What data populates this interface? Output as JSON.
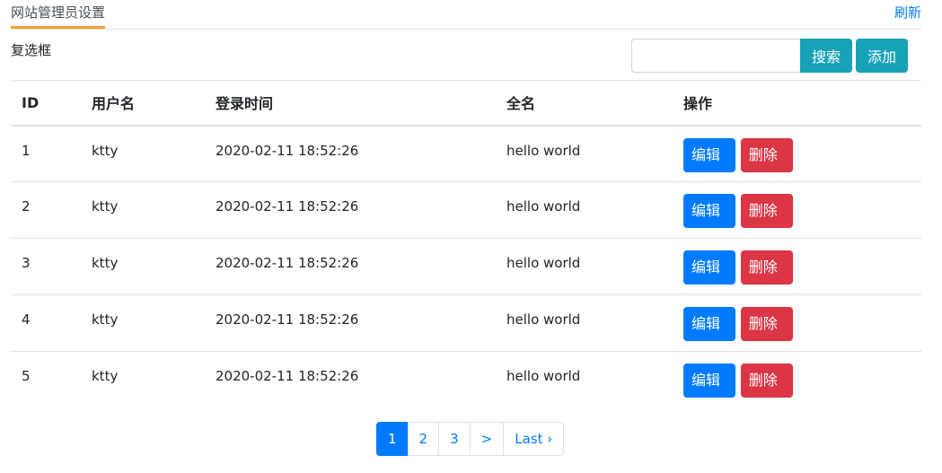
{
  "header": {
    "tab_title": "网站管理员设置",
    "refresh_label": "刷新"
  },
  "toolbar": {
    "checkbox_label": "复选框",
    "search_value": "",
    "search_label": "搜索",
    "add_label": "添加"
  },
  "table": {
    "columns": [
      "ID",
      "用户名",
      "登录时间",
      "全名",
      "操作"
    ],
    "rows": [
      {
        "id": "1",
        "username": "ktty",
        "login_time": "2020-02-11 18:52:26",
        "fullname": "hello world",
        "edit": "编辑",
        "delete": "删除"
      },
      {
        "id": "2",
        "username": "ktty",
        "login_time": "2020-02-11 18:52:26",
        "fullname": "hello world",
        "edit": "编辑",
        "delete": "删除"
      },
      {
        "id": "3",
        "username": "ktty",
        "login_time": "2020-02-11 18:52:26",
        "fullname": "hello world",
        "edit": "编辑",
        "delete": "删除"
      },
      {
        "id": "4",
        "username": "ktty",
        "login_time": "2020-02-11 18:52:26",
        "fullname": "hello world",
        "edit": "编辑",
        "delete": "删除"
      },
      {
        "id": "5",
        "username": "ktty",
        "login_time": "2020-02-11 18:52:26",
        "fullname": "hello world",
        "edit": "编辑",
        "delete": "删除"
      }
    ]
  },
  "pagination": {
    "pages": [
      "1",
      "2",
      "3",
      ">",
      "Last ›"
    ],
    "active_index": 0
  },
  "colors": {
    "accent_tab": "#f4a52a",
    "link": "#007bff",
    "info": "#17a2b8",
    "primary": "#007bff",
    "danger": "#dc3545"
  }
}
